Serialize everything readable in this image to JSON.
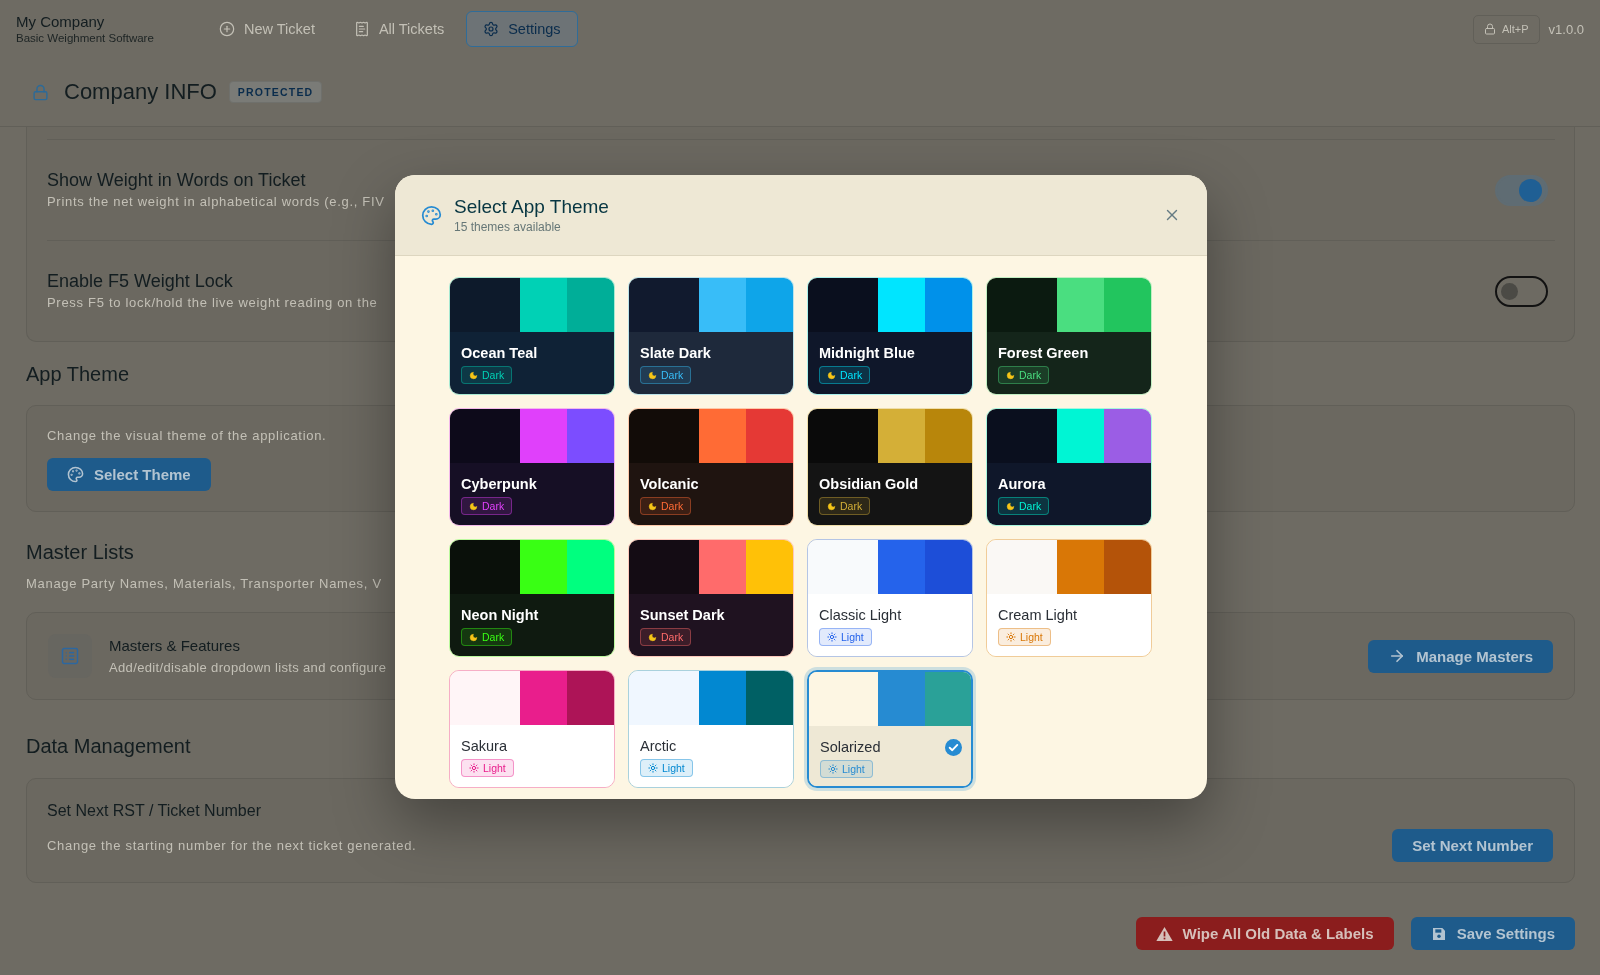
{
  "app": {
    "company": "My Company",
    "tagline": "Basic Weighment Software"
  },
  "nav": [
    {
      "label": "New Ticket",
      "kind": "new",
      "selected": false
    },
    {
      "label": "All Tickets",
      "kind": "list",
      "selected": false
    },
    {
      "label": "Settings",
      "kind": "settings",
      "selected": true
    }
  ],
  "lock_button": {
    "label": "Alt+P"
  },
  "version": "v1.0.0",
  "page_header": {
    "title": "Company INFO",
    "badge": "PROTECTED"
  },
  "options": [
    {
      "title": "Show Weight in Words on Ticket",
      "description": "Prints the net weight in alphabetical words (e.g., FIV",
      "on": true
    },
    {
      "title": "Enable F5 Weight Lock",
      "description": "Press F5 to lock/hold the live weight reading on the",
      "on": false
    }
  ],
  "theme_section": {
    "heading": "App Theme",
    "description": "Change the visual theme of the application.",
    "button": "Select Theme"
  },
  "master_section": {
    "heading": "Master Lists",
    "description": "Manage Party Names, Materials, Transporter Names, V",
    "item": {
      "title": "Masters & Features",
      "description": "Add/edit/disable dropdown lists and configure",
      "button": "Manage Masters"
    }
  },
  "data_section": {
    "heading": "Data Management",
    "item": {
      "title": "Set Next RST / Ticket Number",
      "description": "Change the starting number for the next ticket generated.",
      "button": "Set Next Number"
    }
  },
  "footer_buttons": [
    {
      "label": "Wipe All Old Data & Labels",
      "kind": "danger"
    },
    {
      "label": "Save Settings",
      "kind": "save"
    }
  ],
  "theme_dialog": {
    "title": "Select App Theme",
    "subtitle": "15 themes available",
    "themes": [
      {
        "name": "Ocean Teal",
        "mode": "Dark",
        "kind": "dark",
        "swatches": [
          {
            "color": "#0d1a2b"
          },
          {
            "color": "#00d1b5"
          },
          {
            "color": "#00ae98"
          }
        ],
        "footer": {
          "color": "#0f2236"
        },
        "selected": false
      },
      {
        "name": "Slate Dark",
        "mode": "Dark",
        "kind": "dark",
        "swatches": [
          {
            "color": "#111a2e"
          },
          {
            "color": "#38bdf8"
          },
          {
            "color": "#0ea5e9"
          }
        ],
        "footer": {
          "color": "#1e293b"
        },
        "selected": false
      },
      {
        "name": "Midnight Blue",
        "mode": "Dark",
        "kind": "dark",
        "swatches": [
          {
            "color": "#0a0f1e"
          },
          {
            "color": "#00e5ff"
          },
          {
            "color": "#0091ea"
          }
        ],
        "footer": {
          "color": "#0f172a"
        },
        "selected": false
      },
      {
        "name": "Forest Green",
        "mode": "Dark",
        "kind": "dark",
        "swatches": [
          {
            "color": "#0b1a10"
          },
          {
            "color": "#4ade80"
          },
          {
            "color": "#22c55e"
          }
        ],
        "footer": {
          "color": "#14251a"
        },
        "selected": false
      },
      {
        "name": "Cyberpunk",
        "mode": "Dark",
        "kind": "dark",
        "swatches": [
          {
            "color": "#0d0a1a"
          },
          {
            "color": "#e040fb"
          },
          {
            "color": "#7c4dff"
          }
        ],
        "footer": {
          "color": "#160f25"
        },
        "selected": false
      },
      {
        "name": "Volcanic",
        "mode": "Dark",
        "kind": "dark",
        "swatches": [
          {
            "color": "#120c08"
          },
          {
            "color": "#ff6b35"
          },
          {
            "color": "#e53935"
          }
        ],
        "footer": {
          "color": "#1f1410"
        },
        "selected": false
      },
      {
        "name": "Obsidian Gold",
        "mode": "Dark",
        "kind": "dark",
        "swatches": [
          {
            "color": "#0a0a0a"
          },
          {
            "color": "#d4af37"
          },
          {
            "color": "#b8860b"
          }
        ],
        "footer": {
          "color": "#141414"
        },
        "selected": false
      },
      {
        "name": "Aurora",
        "mode": "Dark",
        "kind": "dark",
        "swatches": [
          {
            "color": "#0a0f1e"
          },
          {
            "color": "#00f5d4"
          },
          {
            "color": "#9b5de5"
          }
        ],
        "footer": {
          "color": "#0f172a"
        },
        "selected": false
      },
      {
        "name": "Neon Night",
        "mode": "Dark",
        "kind": "dark",
        "swatches": [
          {
            "color": "#0a100a"
          },
          {
            "color": "#39ff14"
          },
          {
            "color": "#00ff7f"
          }
        ],
        "footer": {
          "color": "#0f1a10"
        },
        "selected": false
      },
      {
        "name": "Sunset Dark",
        "mode": "Dark",
        "kind": "dark",
        "swatches": [
          {
            "color": "#140c14"
          },
          {
            "color": "#ff6b6b"
          },
          {
            "color": "#ffc107"
          }
        ],
        "footer": {
          "color": "#1f1220"
        },
        "selected": false
      },
      {
        "name": "Classic Light",
        "mode": "Light",
        "kind": "light",
        "swatches": [
          {
            "color": "#f8fafc"
          },
          {
            "color": "#2563eb"
          },
          {
            "color": "#1d4ed8"
          }
        ],
        "footer": {
          "color": "#ffffff"
        },
        "selected": false
      },
      {
        "name": "Cream Light",
        "mode": "Light",
        "kind": "light",
        "swatches": [
          {
            "color": "#faf8f5"
          },
          {
            "color": "#d97706"
          },
          {
            "color": "#b45309"
          }
        ],
        "footer": {
          "color": "#ffffff"
        },
        "selected": false
      },
      {
        "name": "Sakura",
        "mode": "Light",
        "kind": "light",
        "swatches": [
          {
            "color": "#fff5f7"
          },
          {
            "color": "#e91e8c"
          },
          {
            "color": "#ad1457"
          }
        ],
        "footer": {
          "color": "#ffffff"
        },
        "selected": false
      },
      {
        "name": "Arctic",
        "mode": "Light",
        "kind": "light",
        "swatches": [
          {
            "color": "#f0f7ff"
          },
          {
            "color": "#0288d1"
          },
          {
            "color": "#006064"
          }
        ],
        "footer": {
          "color": "#ffffff"
        },
        "selected": false
      },
      {
        "name": "Solarized",
        "mode": "Light",
        "kind": "light",
        "swatches": [
          {
            "color": "#fdf6e3"
          },
          {
            "color": "#268bd2"
          },
          {
            "color": "#2aa198"
          }
        ],
        "footer": {
          "color": "#eee8d5"
        },
        "selected": true
      }
    ]
  }
}
